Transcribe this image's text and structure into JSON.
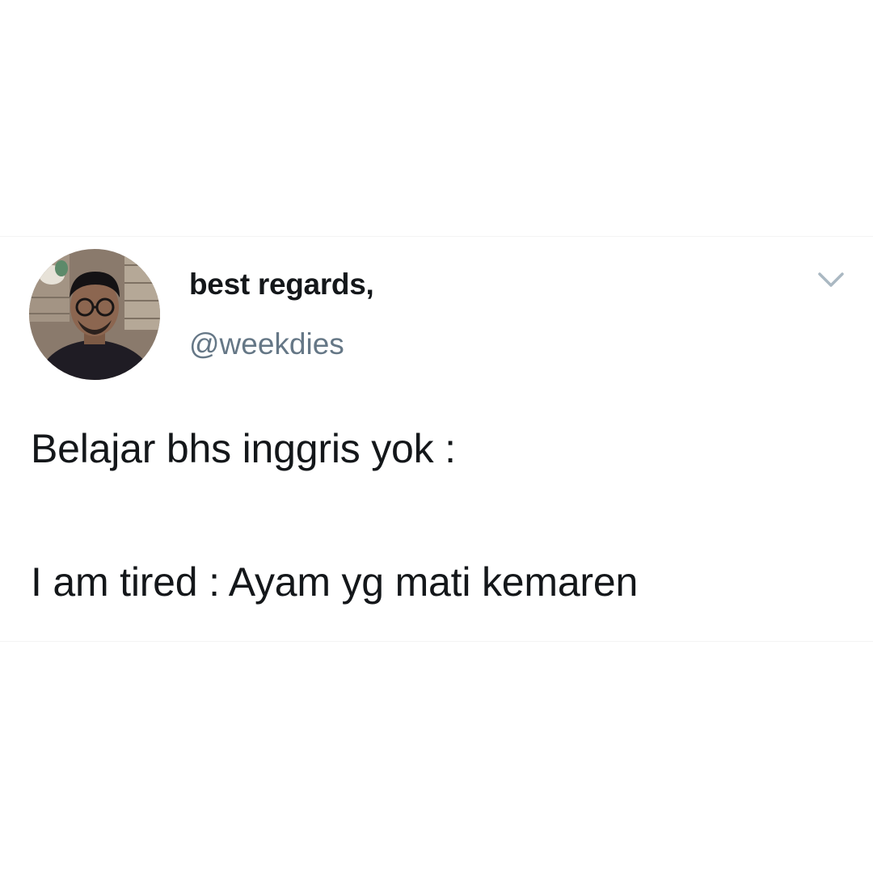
{
  "tweet": {
    "author": {
      "display_name": "best regards,",
      "handle": "@weekdies",
      "avatar_icon": "avatar-photo"
    },
    "menu_icon": "chevron-down-icon",
    "text_lines": [
      "Belajar bhs inggris yok :",
      "I am tired : Ayam yg mati kemaren"
    ]
  },
  "colors": {
    "background": "#ffffff",
    "text": "#14171a",
    "handle": "#657786",
    "chevron": "#aab8c2"
  }
}
